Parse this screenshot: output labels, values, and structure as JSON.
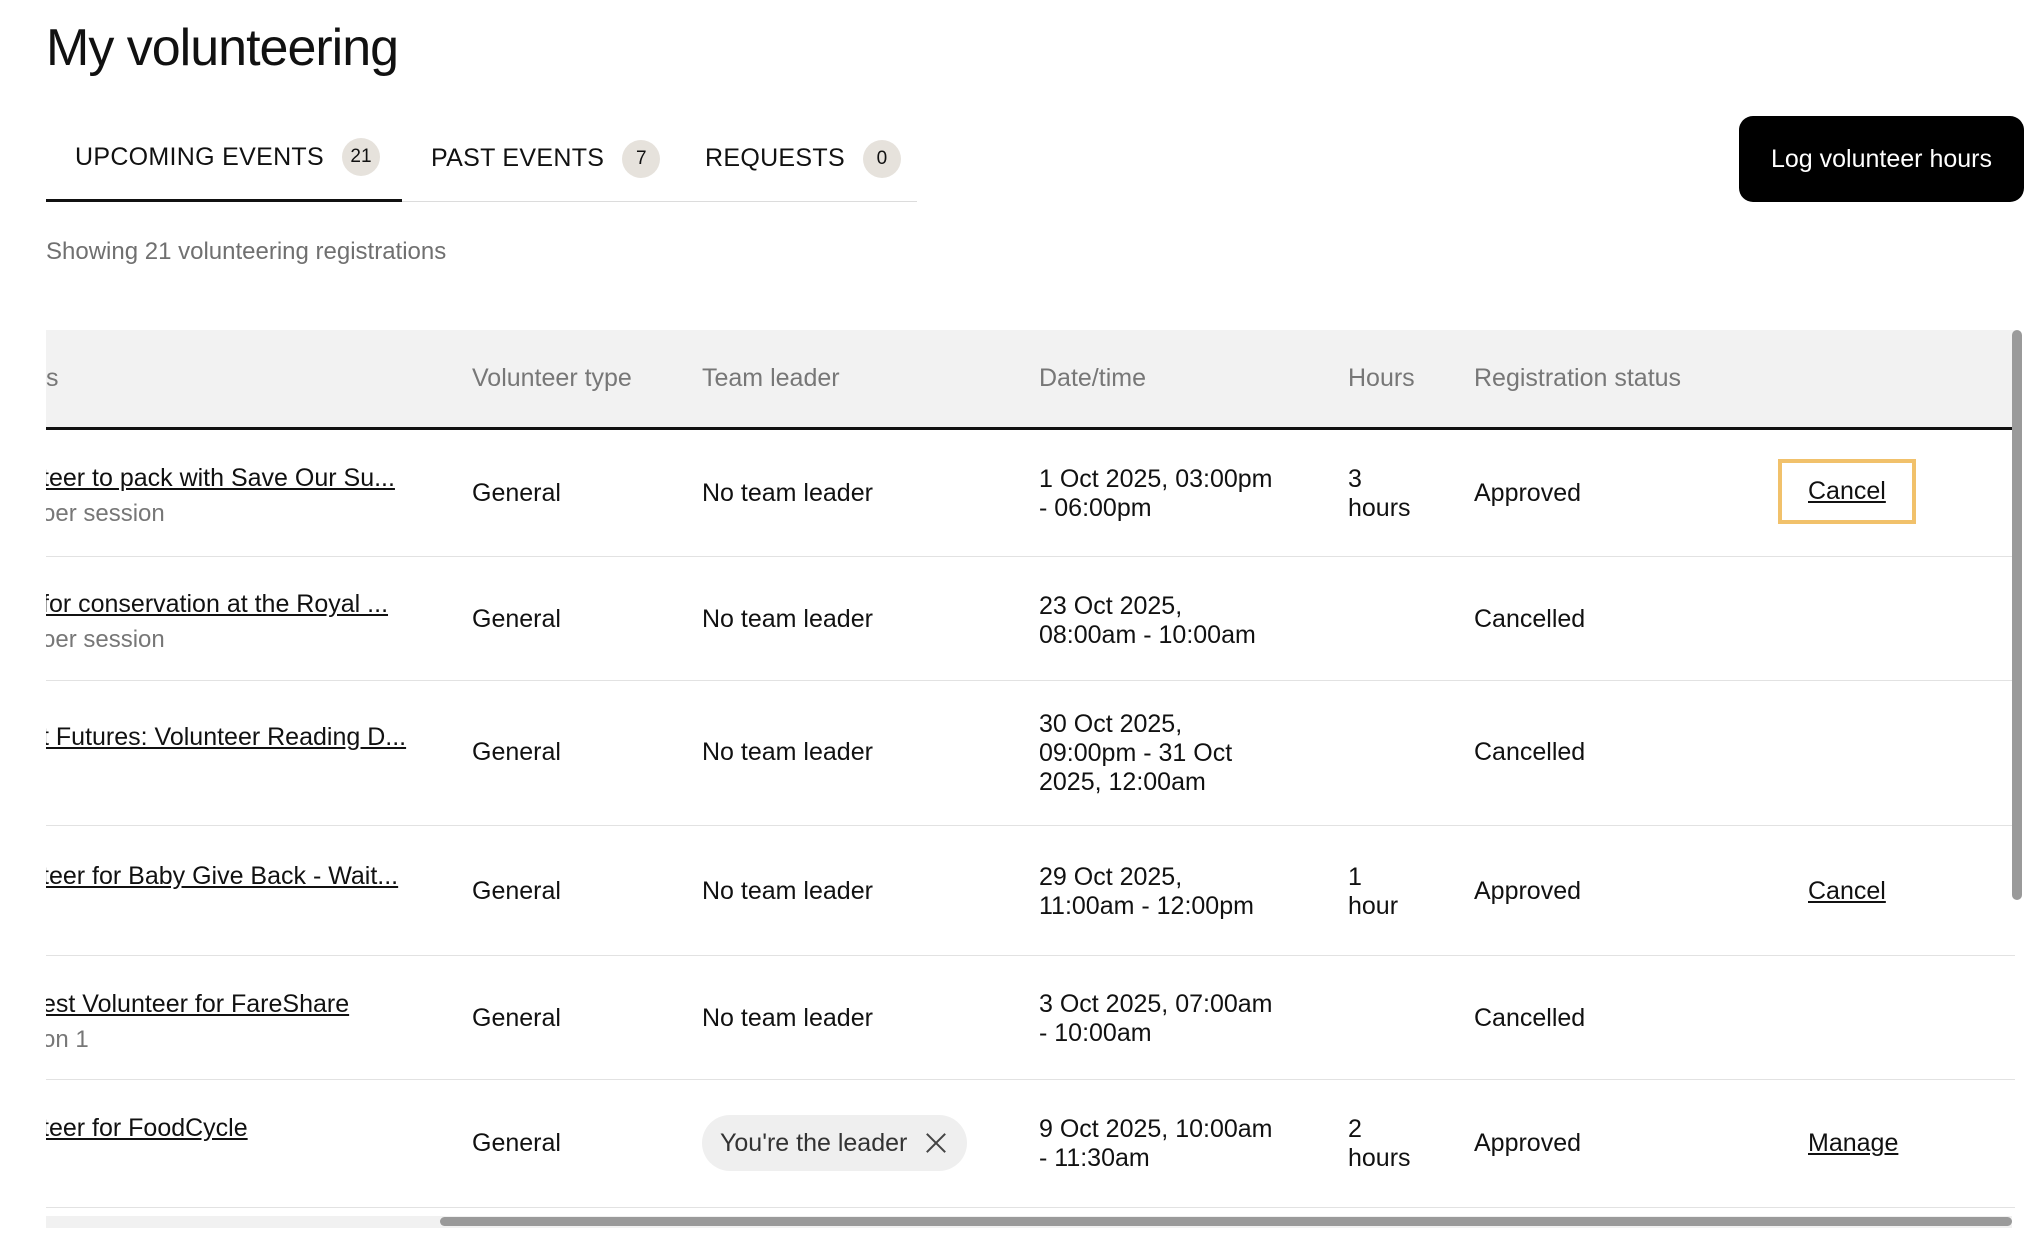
{
  "page": {
    "title": "My volunteering",
    "showing_text": "Showing 21 volunteering registrations"
  },
  "tabs": [
    {
      "label": "UPCOMING EVENTS",
      "count": "21",
      "active": true
    },
    {
      "label": "PAST EVENTS",
      "count": "7",
      "active": false
    },
    {
      "label": "REQUESTS",
      "count": "0",
      "active": false
    }
  ],
  "actions": {
    "log_hours_label": "Log volunteer hours"
  },
  "table": {
    "headers": {
      "event": "s",
      "volunteer_type": "Volunteer type",
      "team_leader": "Team leader",
      "datetime": "Date/time",
      "hours": "Hours",
      "status": "Registration status"
    },
    "rows": [
      {
        "title": "teer to pack with Save Our Su...",
        "subtitle": "oer session",
        "volunteer_type": "General",
        "team_leader": "No team leader",
        "datetime_lines": [
          "1 Oct 2025, 03:00pm",
          "- 06:00pm"
        ],
        "hours_lines": [
          "3",
          "hours"
        ],
        "status": "Approved",
        "action": "Cancel"
      },
      {
        "title": "for conservation at the Royal ...",
        "subtitle": "oer session",
        "volunteer_type": "General",
        "team_leader": "No team leader",
        "datetime_lines": [
          "23 Oct 2025,",
          "08:00am - 10:00am"
        ],
        "hours_lines": [],
        "status": "Cancelled",
        "action": ""
      },
      {
        "title": "t Futures: Volunteer Reading D...",
        "subtitle": "",
        "volunteer_type": "General",
        "team_leader": "No team leader",
        "datetime_lines": [
          "30 Oct 2025,",
          "09:00pm - 31 Oct",
          "2025, 12:00am"
        ],
        "hours_lines": [],
        "status": "Cancelled",
        "action": ""
      },
      {
        "title": "teer for Baby Give Back - Wait...",
        "subtitle": "",
        "volunteer_type": "General",
        "team_leader": "No team leader",
        "datetime_lines": [
          "29 Oct 2025,",
          "11:00am - 12:00pm"
        ],
        "hours_lines": [
          "1",
          "hour"
        ],
        "status": "Approved",
        "action": "Cancel"
      },
      {
        "title": "est Volunteer for FareShare",
        "subtitle": "on 1",
        "volunteer_type": "General",
        "team_leader": "No team leader",
        "datetime_lines": [
          "3 Oct 2025, 07:00am",
          "- 10:00am"
        ],
        "hours_lines": [],
        "status": "Cancelled",
        "action": ""
      },
      {
        "title": "teer for FoodCycle",
        "subtitle": "",
        "volunteer_type": "General",
        "team_leader_chip": "You're the leader",
        "datetime_lines": [
          "9 Oct 2025, 10:00am",
          "- 11:30am"
        ],
        "hours_lines": [
          "2",
          "hours"
        ],
        "status": "Approved",
        "action": "Manage"
      }
    ]
  }
}
